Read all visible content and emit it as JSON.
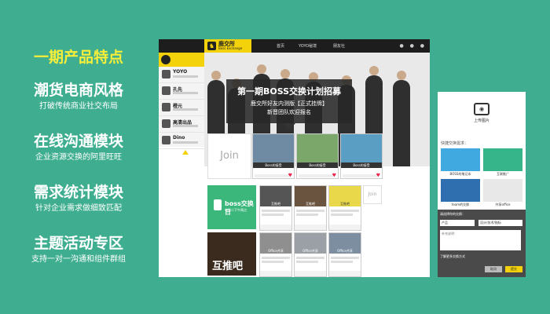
{
  "left": {
    "headline": "一期产品特点",
    "features": [
      {
        "title": "潮货电商风格",
        "subtitle": "打破传统商业社交布局"
      },
      {
        "title": "在线沟通模块",
        "subtitle": "企业资源交换的阿里旺旺"
      },
      {
        "title": "需求统计模块",
        "subtitle": "针对企业需求做细致匹配"
      },
      {
        "title": "主题活动专区",
        "subtitle": "支持一对一沟通和组件群组"
      }
    ]
  },
  "app": {
    "brand": "鹿交所",
    "brand_sub": "Boss Exchange",
    "brand_tag": "beta",
    "nav": [
      "首页",
      "YOYO秘境",
      "朋友社"
    ],
    "sidebar": {
      "user_label": "YOYO",
      "items": [
        "孔先",
        "橙元",
        "高清出品",
        "Dino"
      ]
    },
    "banner": {
      "title": "第一期BOSS交换计划招募",
      "line2": "鹿交所好友内测版【正式挂牌】",
      "line3": "新晋团队欢迎报名"
    },
    "join_label": "Join",
    "cards": [
      "Boss的接受",
      "Boss的接受",
      "Boss的接受"
    ],
    "boss_day": {
      "title": "boss交换日",
      "sub": "每周二下午两点"
    },
    "grid": [
      "互推吧",
      "互推吧",
      "互推吧",
      "Office共享",
      "Office共享",
      "Office共享"
    ],
    "hutui_label": "互推吧"
  },
  "phone": {
    "upload_label": "上传图片",
    "prompt": "快捷交换需求：",
    "tiles": [
      "BOSS的笔记本",
      "互联推广",
      "team的交换",
      "共享office"
    ],
    "form": {
      "label": "请选择你的交换：",
      "select1": "产品",
      "select2": "设计/技术/指标",
      "textarea_placeholder": "补充说明：",
      "option_text": "了解更多交换方式",
      "cancel": "取消",
      "submit": "提交"
    }
  }
}
